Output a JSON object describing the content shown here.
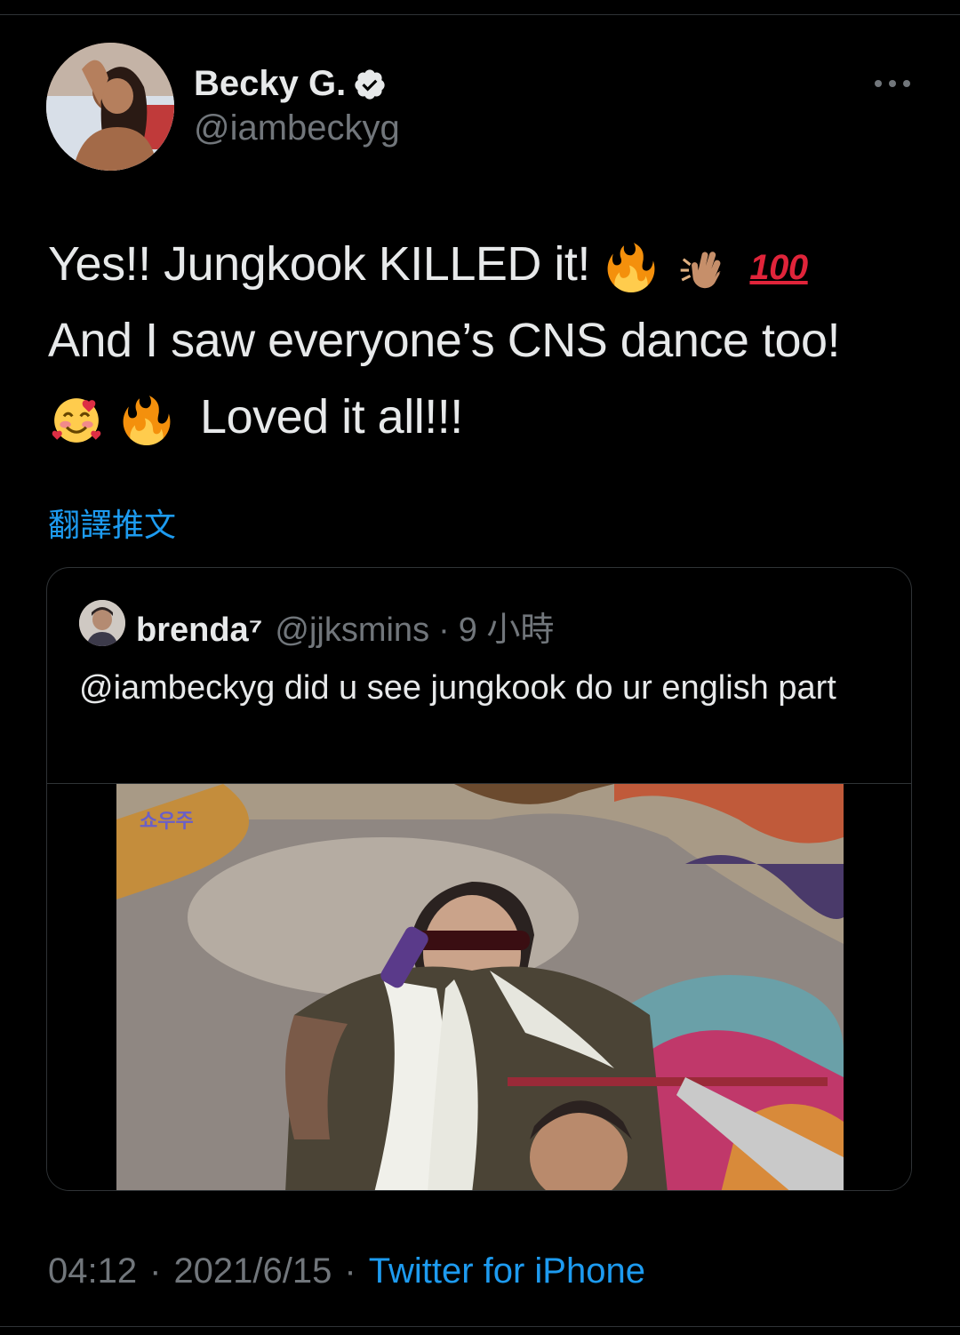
{
  "tweet": {
    "author": {
      "display_name": "Becky G.",
      "handle": "@iambeckyg",
      "verified": true
    },
    "text_lines": [
      "Yes!! Jungkook KILLED it!",
      "And I saw everyone’s CNS dance too!",
      "Loved it all!!!"
    ],
    "emojis": [
      "fire-icon",
      "clapping-hands-icon",
      "hundred-points-icon",
      "smiling-face-with-hearts-icon",
      "fire-icon"
    ],
    "hundred_label": "100",
    "translate_label": "翻譯推文",
    "timestamp": "04:12",
    "date": "2021/6/15",
    "source": "Twitter for iPhone",
    "separator": "·"
  },
  "quote": {
    "display_name": "brenda⁷",
    "handle": "@jjksmins",
    "time": "9 小時",
    "separator": "·",
    "text": "@iambeckyg did u see jungkook do ur english part",
    "media_logo": "쇼우주"
  },
  "colors": {
    "background": "#000000",
    "text": "#e7e9ea",
    "secondary": "#71767b",
    "link": "#1d9bf0",
    "border": "#2f3336"
  }
}
